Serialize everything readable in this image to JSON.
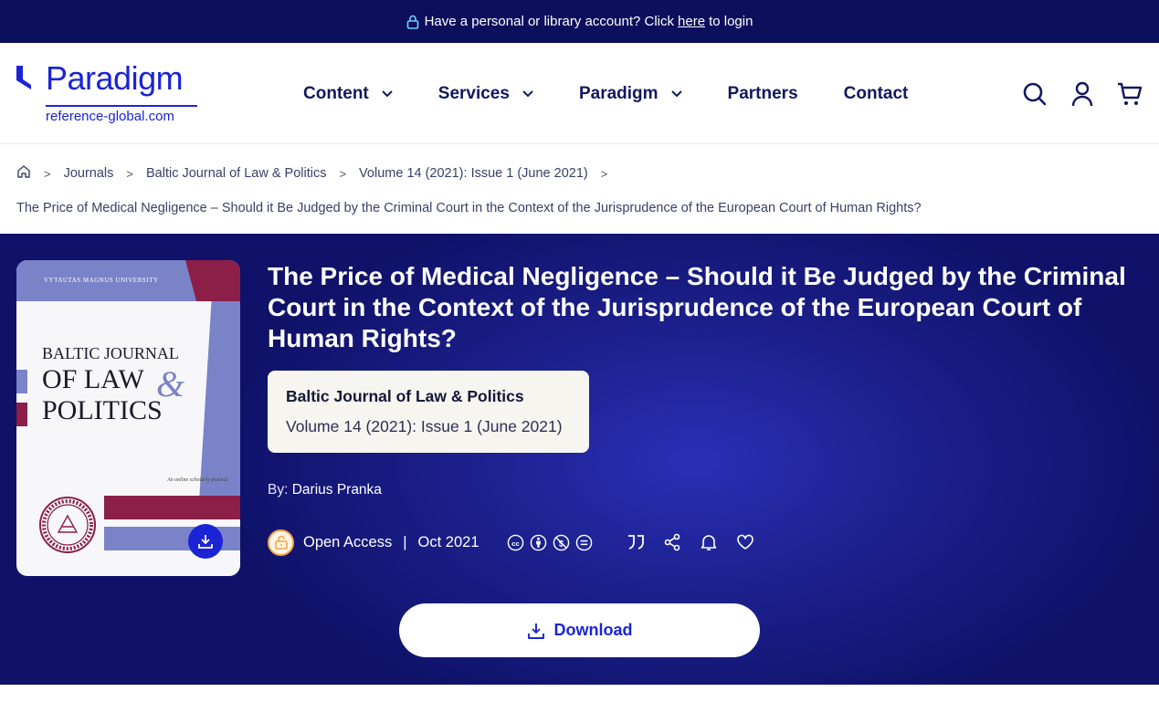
{
  "banner": {
    "text_before": "Have a personal or library account? Click",
    "link": "here",
    "text_after": "to login"
  },
  "logo": {
    "name": "Paradigm",
    "domain": "reference-global.com"
  },
  "nav": {
    "items": [
      {
        "label": "Content",
        "dropdown": true
      },
      {
        "label": "Services",
        "dropdown": true
      },
      {
        "label": "Paradigm",
        "dropdown": true
      },
      {
        "label": "Partners",
        "dropdown": false
      },
      {
        "label": "Contact",
        "dropdown": false
      }
    ]
  },
  "header_icons": [
    "search-icon",
    "account-icon",
    "cart-icon"
  ],
  "breadcrumb": {
    "items": [
      "Journals",
      "Baltic Journal of Law & Politics",
      "Volume 14 (2021): Issue 1 (June 2021)"
    ],
    "current": "The Price of Medical Negligence – Should it Be Judged by the Criminal Court in the Context of the Jurisprudence of the European Court of Human Rights?"
  },
  "cover": {
    "university": "VYTAUTAS MAGNUS UNIVERSITY",
    "line1": "BALTIC JOURNAL",
    "line2": "OF LAW",
    "ampersand": "&",
    "line3": "POLITICS",
    "tagline": "An online scholarly journal"
  },
  "article": {
    "title": "The Price of Medical Negligence – Should it Be Judged by the Criminal Court in the Context of the Jurisprudence of the European Court of Human Rights?",
    "journal": "Baltic Journal of Law & Politics",
    "volume": "Volume 14 (2021): Issue 1 (June 2021)",
    "by_label": "By:",
    "author": "Darius Pranka",
    "access": "Open Access",
    "separator": "|",
    "date": "Oct 2021"
  },
  "download": {
    "label": "Download"
  },
  "colors": {
    "brand": "#1a24d6",
    "navy": "#0c0f5c",
    "accent_red": "#8b1f48",
    "periwinkle": "#7a83c7"
  }
}
